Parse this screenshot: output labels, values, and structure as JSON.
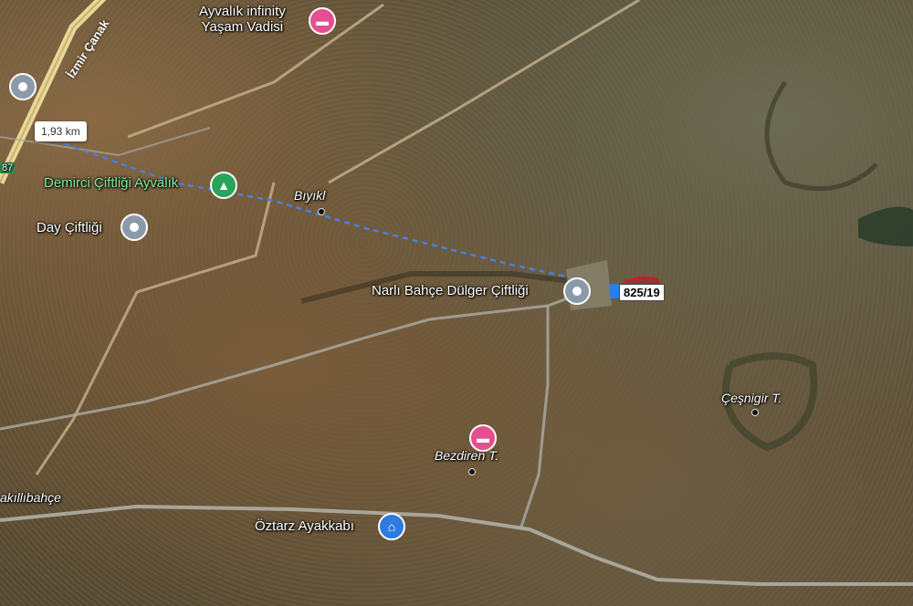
{
  "road_label": "İzmir Çanak",
  "distance": "1,93 km",
  "road_number": "87",
  "places": {
    "ayvalik_infinity": "Ayvalık infinity\nYaşam Vadisi",
    "ayvalik_infinity_line1": "Ayvalık infinity",
    "ayvalik_infinity_line2": "Yaşam Vadisi",
    "demirci": "Demirci Çiftliği Ayvalık",
    "day": "Day Çiftliği",
    "biyikl": "Bıyıkl",
    "narli": "Narlı Bahçe Dülger Çiftliği",
    "cesnigir": "Çeşnigir T.",
    "bezdiren": "Bezdiren T.",
    "akillibahce": "akıllıbahçe",
    "oztarz": "Öztarz Ayakkabı"
  },
  "parcel": "825/19",
  "icons": {
    "hotel": "bed-icon",
    "camp": "tent-icon",
    "shop": "shopping-bag-icon",
    "place": "location-pin-icon"
  },
  "colors": {
    "hotel": "#e64f8f",
    "camp": "#26a55a",
    "shop": "#2e7ae0",
    "route": "#4a7fe0",
    "parcel": "#b01a2a"
  }
}
